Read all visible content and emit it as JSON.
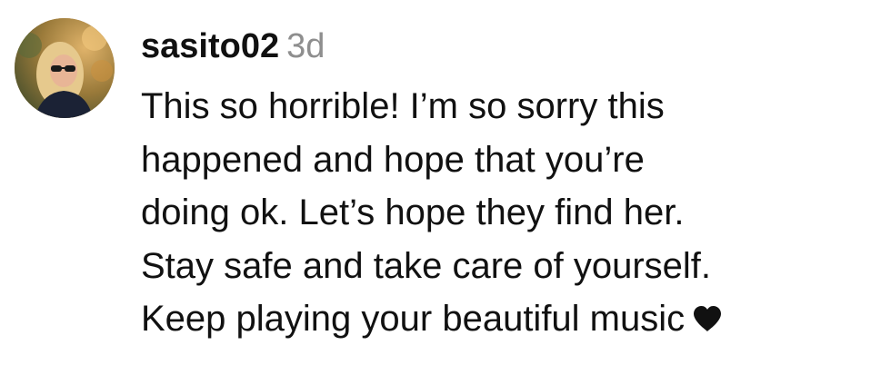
{
  "comment": {
    "username": "sasito02",
    "timestamp": "3d",
    "lines": [
      "This so horrible! I’m so sorry this",
      "happened and hope that you’re",
      "doing ok. Let’s hope they find her.",
      "Stay safe and take care of yourself.",
      "Keep playing your beautiful music"
    ],
    "trailing_icon": "heart-icon",
    "avatar_icon": "profile-photo"
  },
  "colors": {
    "text": "#111111",
    "timestamp": "#8e8e8e",
    "background": "#ffffff"
  }
}
